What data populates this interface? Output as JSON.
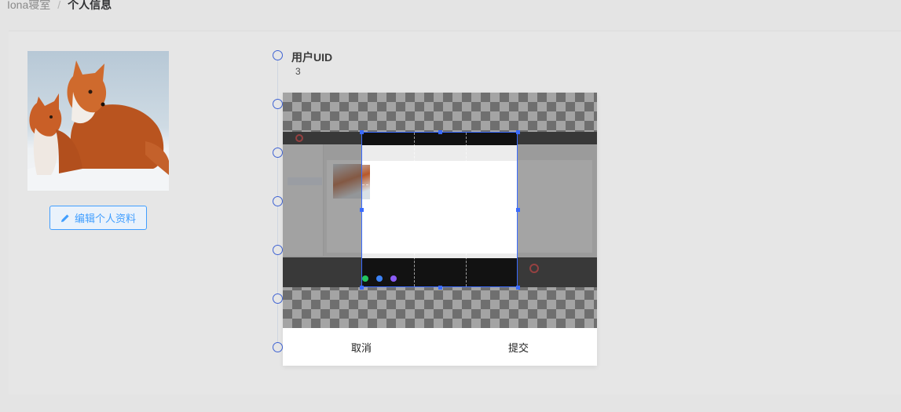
{
  "breadcrumb": {
    "root": "Iona寝室",
    "separator": "/",
    "current": "个人信息"
  },
  "profile": {
    "edit_button_label": "编辑个人资料",
    "avatar_icon": "fox-photo"
  },
  "fields": [
    {
      "title": "用户UID",
      "value": "3"
    }
  ],
  "cropper": {
    "cancel_label": "取消",
    "submit_label": "提交"
  },
  "colors": {
    "accent": "#409eff",
    "timeline": "#3f63d3",
    "crop_border": "#3a6bff",
    "background": "#e4e4e4"
  }
}
